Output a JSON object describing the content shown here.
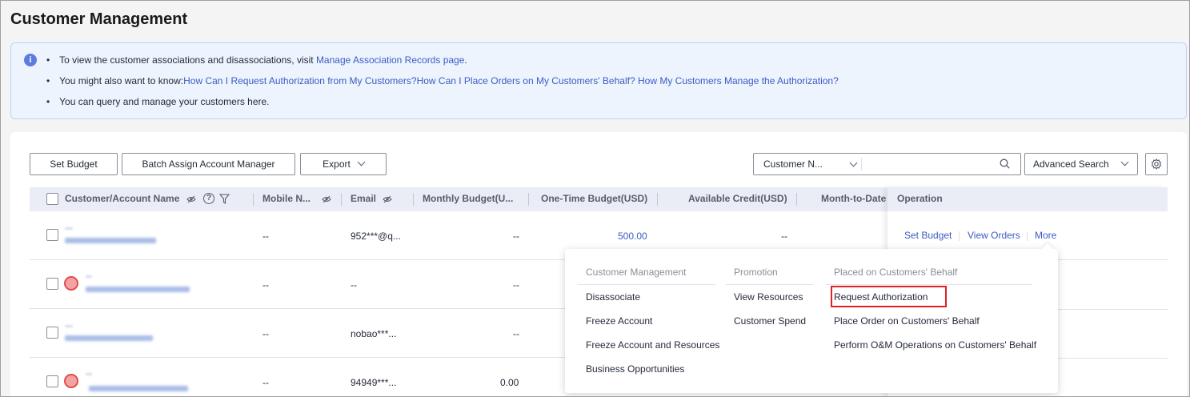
{
  "page": {
    "title": "Customer Management"
  },
  "notice": {
    "line1_text": "To view the customer associations and disassociations, visit ",
    "line1_link": "Manage Association Records page",
    "line1_end": ".",
    "line2_text": "You might also want to know:",
    "line2_link1": "How Can I Request Authorization from My Customers?",
    "line2_link2": "How Can I Place Orders on My Customers' Behalf?",
    "line2_link3": "How My Customers Manage the Authorization?",
    "line3_text": "You can query and manage your customers here.",
    "bullet": "•",
    "info_glyph": "i"
  },
  "toolbar": {
    "set_budget": "Set Budget",
    "batch_assign": "Batch Assign Account Manager",
    "export": "Export",
    "search_field": "Customer N...",
    "search_value": "",
    "advanced_search": "Advanced Search"
  },
  "table": {
    "columns": {
      "name": "Customer/Account Name",
      "mobile": "Mobile N...",
      "email": "Email",
      "monthly": "Monthly Budget(U...",
      "onetime": "One-Time Budget(USD)",
      "credit": "Available Credit(USD)",
      "mtd": "Month-to-Date",
      "operation": "Operation"
    },
    "rows": [
      {
        "mobile": "--",
        "email": "952***@q...",
        "monthly": "--",
        "onetime": "500.00",
        "credit": "--"
      },
      {
        "mobile": "--",
        "email": "--",
        "monthly": "--",
        "onetime": "",
        "credit": ""
      },
      {
        "mobile": "--",
        "email": "nobao***...",
        "monthly": "--",
        "onetime": "",
        "credit": ""
      },
      {
        "mobile": "--",
        "email": "94949***...",
        "monthly": "0.00",
        "onetime": "",
        "credit": ""
      }
    ],
    "row_actions": {
      "set_budget": "Set Budget",
      "view_orders": "View Orders",
      "more": "More"
    }
  },
  "more_menu": {
    "groups": [
      {
        "header": "Customer Management",
        "items": [
          "Disassociate",
          "Freeze Account",
          "Freeze Account and Resources",
          "Business Opportunities"
        ]
      },
      {
        "header": "Promotion",
        "items": [
          "View Resources",
          "Customer Spend"
        ]
      },
      {
        "header": "Placed on Customers' Behalf",
        "items": [
          "Request Authorization",
          "Place Order on Customers' Behalf",
          "Perform O&M Operations on Customers' Behalf"
        ]
      }
    ],
    "highlighted_item": "Request Authorization"
  },
  "colors": {
    "link": "#3b5cc4",
    "notice_bg": "#edf4fe",
    "info_icon": "#5e7ce0",
    "highlight_border": "#e02020",
    "header_bg": "#eaedf5"
  },
  "icons": [
    "info-icon",
    "eye-off-icon",
    "help-icon",
    "filter-icon",
    "chevron-down-icon",
    "search-icon",
    "gear-icon",
    "avatar-icon"
  ]
}
